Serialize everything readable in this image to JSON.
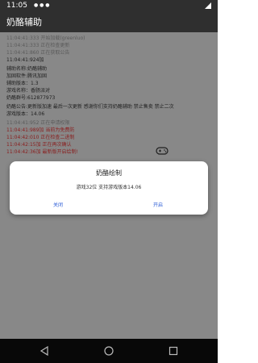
{
  "status_bar": {
    "time": "11:05",
    "indicators": "● ● ●"
  },
  "app_bar": {
    "title": "奶酪辅助"
  },
  "log": {
    "lines": [
      "11:04:41:333  开始加载(greenluo)",
      "11:04:41:333  正在检查更新",
      "11:04:41:860  正在获取公告",
      "11:04:41:924加",
      "辅助名称:奶酪辅助",
      "加固软件:腾讯加固",
      "辅助版本：1.3",
      "游戏名称：香肠派对",
      "奶酪群号:612877973",
      "奶酪公告:更新版加速 最后一次更新 感谢你们支持奶酪辅助  禁止售卖 禁止二次",
      "游戏版本：14.06",
      "11:04:41:952  正在申请权限",
      "11:04:41:989加  当前为免费防",
      "11:04:42:010  正在检查二进制",
      "11:04:42:15加  正在再次确认",
      "11:04:42:36加  最新版开启绘制!"
    ]
  },
  "dialog": {
    "title": "奶酪绘制",
    "message": "游戏32位  支持游戏版本14.06",
    "close_label": "关闭",
    "open_label": "开启"
  },
  "icons": {
    "controller": "gamepad-icon",
    "back": "back-icon",
    "home": "home-icon",
    "recent": "recent-apps-icon"
  },
  "colors": {
    "bar": "#2f2f2f",
    "overlay": "#888888",
    "accent": "#2a5bd6",
    "nav": "#080808"
  }
}
